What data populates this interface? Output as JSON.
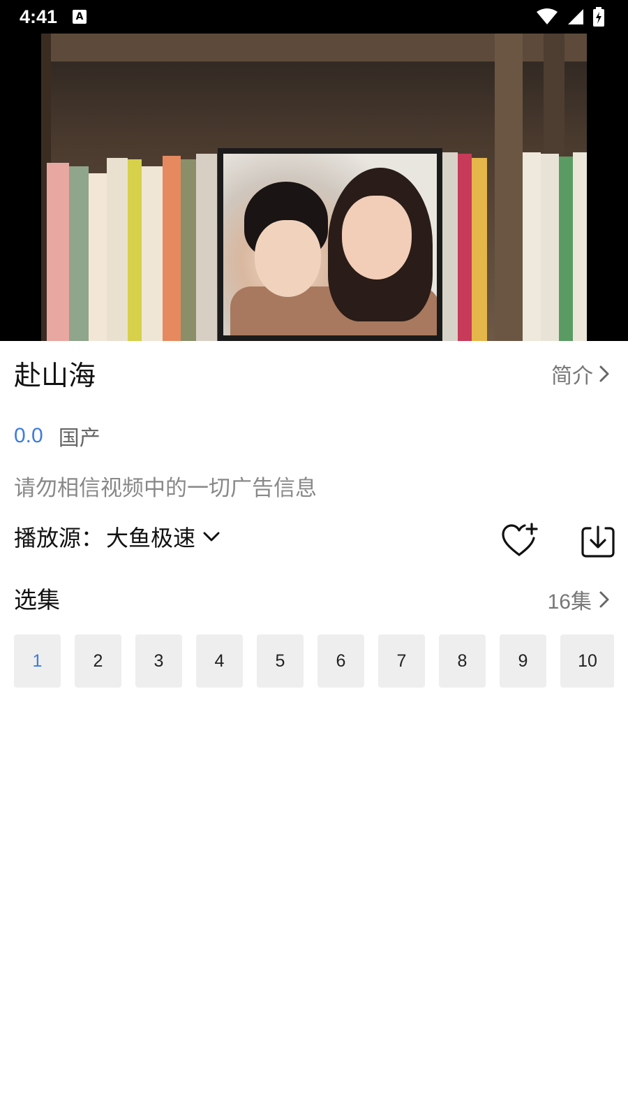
{
  "status_bar": {
    "time": "4:41",
    "notification_icon": "A",
    "icons": [
      "wifi-icon",
      "signal-icon",
      "battery-icon"
    ]
  },
  "video": {
    "description_icon": "video-player"
  },
  "show": {
    "title": "赴山海",
    "intro_label": "简介",
    "score": "0.0",
    "region": "国产",
    "notice": "请勿相信视频中的一切广告信息"
  },
  "source": {
    "label": "播放源：",
    "value": "大鱼极速"
  },
  "episodes": {
    "title": "选集",
    "count_label": "16集",
    "active": "1",
    "items": [
      "1",
      "2",
      "3",
      "4",
      "5",
      "6",
      "7",
      "8",
      "9",
      "10"
    ]
  },
  "colors": {
    "accent": "#3e7cdd",
    "muted_text": "#888888",
    "chip_bg": "#eeeeee"
  }
}
